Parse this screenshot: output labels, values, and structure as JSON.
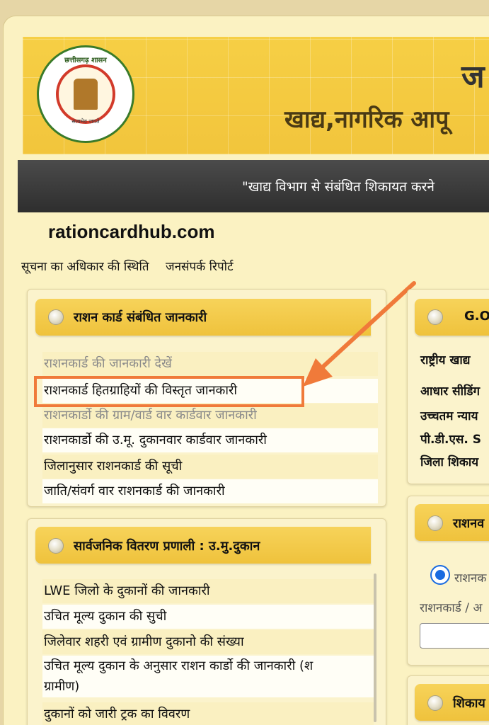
{
  "banner": {
    "emblem_text": "छत्तीसगढ़ शासन",
    "emblem_motto": "सत्यमेव जयते",
    "title_line1": "ज",
    "title_line2": "खाद्य,नागरिक आपू"
  },
  "ticker": {
    "text": "\"खाद्य विभाग से संबंधित शिकायत करने"
  },
  "watermark": "rationcardhub.com",
  "top_links": [
    "सूचना का अधिकार की स्थिति",
    "जनसंपर्क रिपोर्ट"
  ],
  "ration_panel": {
    "title": "राशन कार्ड संबंधित जानकारी",
    "links": [
      "राशनकार्ड की जानकारी देखें",
      "राशनकार्ड हितग्राहियों की विस्तृत जानकारी",
      "राशनकार्डो की ग्राम/वार्ड वार कार्डवार जानकारी",
      "राशनकार्डो की उ.मू. दुकानवार कार्डवार जानकारी",
      "जिलानुसार राशनकार्ड की सूची",
      "जाति/संवर्ग वार राशनकार्ड की जानकारी"
    ]
  },
  "pds_panel": {
    "title": "सार्वजनिक वितरण प्रणाली : उ.मु.दुकान",
    "links": [
      "LWE जिलो के दुकानों की जानकारी",
      "उचित मूल्य दुकान की सुची",
      "जिलेवार शहरी एवं ग्रामीण दुकानो की संख्या",
      "उचित मूल्य दुकान के अनुसार राशन कार्डो की जानकारी (श",
      "ग्रामीण)",
      "दुकानों को जारी ट्रक का विवरण"
    ]
  },
  "right_go_panel": {
    "title": "G.O",
    "items": [
      "राष्ट्रीय खाद्य",
      "आधार सीडिंग",
      "उच्चतम न्याय",
      "पी.डी.एस. S",
      "जिला शिकाय"
    ]
  },
  "right_ration_panel": {
    "title": "राशनव",
    "radio_label": "राशनक",
    "field_label": "राशनकार्ड / अ",
    "input_value": ""
  },
  "right_complaint_panel": {
    "title": "शिकाय"
  },
  "colors": {
    "highlight": "#f07a3a",
    "header_gold": "#efc23c",
    "ticker_bg": "#2e2e2e"
  }
}
